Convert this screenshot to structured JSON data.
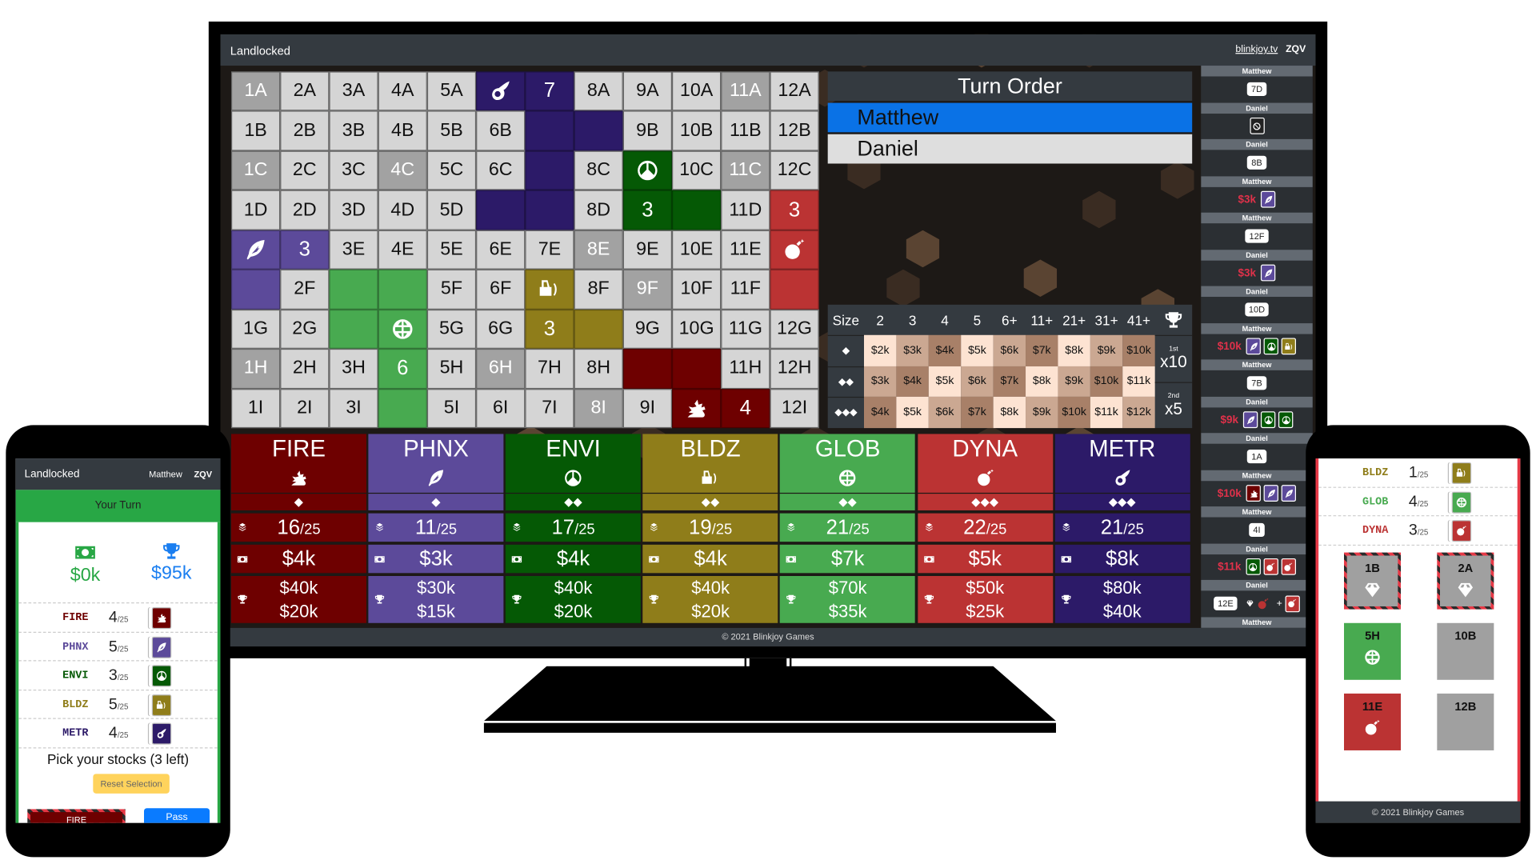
{
  "app": {
    "title": "Landlocked",
    "link": "blinkjoy.tv",
    "room": "ZQV",
    "footer": "© 2021 Blinkjoy Games"
  },
  "colors": {
    "FIRE": "#6e0000",
    "PHNX": "#5c4a9a",
    "ENVI": "#055905",
    "BLDZ": "#8f7d1a",
    "GLOB": "#48aa50",
    "DYNA": "#bb3333",
    "METR": "#2c1a68",
    "active": "#0a72e6",
    "your_turn": "#28a745",
    "cash": "#28a745",
    "worth": "#1a7ef0",
    "reset": "#ffd35c",
    "pass": "#0a7bff"
  },
  "icons": {
    "FIRE": "dragon",
    "PHNX": "feather",
    "ENVI": "peace",
    "BLDZ": "bulldozer",
    "GLOB": "globe",
    "DYNA": "bomb",
    "METR": "comet"
  },
  "board": {
    "rows": [
      [
        {
          "t": "1A",
          "dark": true
        },
        {
          "t": "2A"
        },
        {
          "t": "3A"
        },
        {
          "t": "4A"
        },
        {
          "t": "5A"
        },
        {
          "co": "METR",
          "icon": true
        },
        {
          "co": "METR",
          "t": "7"
        },
        {
          "t": "8A"
        },
        {
          "t": "9A"
        },
        {
          "t": "10A"
        },
        {
          "t": "11A",
          "dark": true
        },
        {
          "t": "12A"
        }
      ],
      [
        {
          "t": "1B"
        },
        {
          "t": "2B"
        },
        {
          "t": "3B"
        },
        {
          "t": "4B"
        },
        {
          "t": "5B"
        },
        {
          "t": "6B"
        },
        {
          "co": "METR"
        },
        {
          "co": "METR"
        },
        {
          "t": "9B"
        },
        {
          "t": "10B"
        },
        {
          "t": "11B"
        },
        {
          "t": "12B"
        }
      ],
      [
        {
          "t": "1C",
          "dark": true
        },
        {
          "t": "2C"
        },
        {
          "t": "3C"
        },
        {
          "t": "4C",
          "dark": true
        },
        {
          "t": "5C"
        },
        {
          "t": "6C"
        },
        {
          "co": "METR"
        },
        {
          "t": "8C"
        },
        {
          "co": "ENVI",
          "icon": true
        },
        {
          "t": "10C"
        },
        {
          "t": "11C",
          "dark": true
        },
        {
          "t": "12C"
        }
      ],
      [
        {
          "t": "1D"
        },
        {
          "t": "2D"
        },
        {
          "t": "3D"
        },
        {
          "t": "4D"
        },
        {
          "t": "5D"
        },
        {
          "co": "METR"
        },
        {
          "co": "METR"
        },
        {
          "t": "8D"
        },
        {
          "co": "ENVI",
          "t": "3"
        },
        {
          "co": "ENVI"
        },
        {
          "t": "11D"
        },
        {
          "co": "DYNA",
          "t": "3"
        }
      ],
      [
        {
          "co": "PHNX",
          "icon": true
        },
        {
          "co": "PHNX",
          "t": "3"
        },
        {
          "t": "3E"
        },
        {
          "t": "4E"
        },
        {
          "t": "5E"
        },
        {
          "t": "6E"
        },
        {
          "t": "7E"
        },
        {
          "t": "8E",
          "dark": true
        },
        {
          "t": "9E"
        },
        {
          "t": "10E"
        },
        {
          "t": "11E"
        },
        {
          "co": "DYNA",
          "icon": true
        }
      ],
      [
        {
          "co": "PHNX"
        },
        {
          "t": "2F"
        },
        {
          "co": "GLOB"
        },
        {
          "co": "GLOB"
        },
        {
          "t": "5F"
        },
        {
          "t": "6F"
        },
        {
          "co": "BLDZ",
          "icon": true
        },
        {
          "t": "8F"
        },
        {
          "t": "9F",
          "dark": true
        },
        {
          "t": "10F"
        },
        {
          "t": "11F"
        },
        {
          "co": "DYNA"
        }
      ],
      [
        {
          "t": "1G"
        },
        {
          "t": "2G"
        },
        {
          "co": "GLOB"
        },
        {
          "co": "GLOB",
          "icon": true
        },
        {
          "t": "5G"
        },
        {
          "t": "6G"
        },
        {
          "co": "BLDZ",
          "t": "3"
        },
        {
          "co": "BLDZ"
        },
        {
          "t": "9G"
        },
        {
          "t": "10G"
        },
        {
          "t": "11G"
        },
        {
          "t": "12G"
        }
      ],
      [
        {
          "t": "1H",
          "dark": true
        },
        {
          "t": "2H"
        },
        {
          "t": "3H"
        },
        {
          "co": "GLOB",
          "t": "6"
        },
        {
          "t": "5H"
        },
        {
          "t": "6H",
          "dark": true
        },
        {
          "t": "7H"
        },
        {
          "t": "8H"
        },
        {
          "co": "FIRE"
        },
        {
          "co": "FIRE"
        },
        {
          "t": "11H"
        },
        {
          "t": "12H"
        }
      ],
      [
        {
          "t": "1I"
        },
        {
          "t": "2I"
        },
        {
          "t": "3I"
        },
        {
          "co": "GLOB"
        },
        {
          "t": "5I"
        },
        {
          "t": "6I"
        },
        {
          "t": "7I"
        },
        {
          "t": "8I",
          "dark": true
        },
        {
          "t": "9I"
        },
        {
          "co": "FIRE",
          "icon": true
        },
        {
          "co": "FIRE",
          "t": "4"
        },
        {
          "t": "12I"
        }
      ]
    ]
  },
  "turn_order": {
    "title": "Turn Order",
    "players": [
      {
        "name": "Matthew",
        "active": true
      },
      {
        "name": "Daniel",
        "active": false
      }
    ]
  },
  "price_table": {
    "header": [
      "Size",
      "2",
      "3",
      "4",
      "5",
      "6+",
      "11+",
      "21+",
      "31+",
      "41+"
    ],
    "rows": [
      {
        "size": "◆",
        "prices": [
          "$2k",
          "$3k",
          "$4k",
          "$5k",
          "$6k",
          "$7k",
          "$8k",
          "$9k",
          "$10k"
        ]
      },
      {
        "size": "◆◆",
        "prices": [
          "$3k",
          "$4k",
          "$5k",
          "$6k",
          "$7k",
          "$8k",
          "$9k",
          "$10k",
          "$11k"
        ]
      },
      {
        "size": "◆◆◆",
        "prices": [
          "$4k",
          "$5k",
          "$6k",
          "$7k",
          "$8k",
          "$9k",
          "$10k",
          "$11k",
          "$12k"
        ]
      }
    ],
    "first": {
      "label": "1st",
      "mult": "x10"
    },
    "second": {
      "label": "2nd",
      "mult": "x5"
    }
  },
  "log": [
    {
      "player": "Matthew",
      "tile": "7D"
    },
    {
      "player": "Daniel",
      "blocked": true
    },
    {
      "player": "Daniel",
      "tile": "8B"
    },
    {
      "player": "Matthew",
      "price": "$3k",
      "stocks": [
        "PHNX"
      ]
    },
    {
      "player": "Matthew",
      "tile": "12F"
    },
    {
      "player": "Daniel",
      "price": "$3k",
      "stocks": [
        "PHNX"
      ]
    },
    {
      "player": "Daniel",
      "tile": "10D"
    },
    {
      "player": "Matthew",
      "price": "$10k",
      "stocks": [
        "PHNX",
        "ENVI",
        "BLDZ"
      ]
    },
    {
      "player": "Matthew",
      "tile": "7B"
    },
    {
      "player": "Daniel",
      "price": "$9k",
      "stocks": [
        "PHNX",
        "ENVI",
        "ENVI"
      ]
    },
    {
      "player": "Daniel",
      "tile": "1A"
    },
    {
      "player": "Matthew",
      "price": "$10k",
      "stocks": [
        "FIRE",
        "PHNX",
        "PHNX"
      ]
    },
    {
      "player": "Matthew",
      "tile": "4I"
    },
    {
      "player": "Daniel",
      "price": "$11k",
      "stocks": [
        "ENVI",
        "DYNA",
        "DYNA"
      ]
    },
    {
      "player": "Daniel",
      "tile": "12E",
      "founded": "DYNA",
      "bonus": "+",
      "bonus_stock": "DYNA"
    },
    {
      "player": "Matthew"
    }
  ],
  "companies": [
    {
      "name": "FIRE",
      "size": "◆",
      "shares": "16",
      "total": "/25",
      "price": "$4k",
      "bonus1": "$40k",
      "bonus2": "$20k"
    },
    {
      "name": "PHNX",
      "size": "◆",
      "shares": "11",
      "total": "/25",
      "price": "$3k",
      "bonus1": "$30k",
      "bonus2": "$15k"
    },
    {
      "name": "ENVI",
      "size": "◆◆",
      "shares": "17",
      "total": "/25",
      "price": "$4k",
      "bonus1": "$40k",
      "bonus2": "$20k"
    },
    {
      "name": "BLDZ",
      "size": "◆◆",
      "shares": "19",
      "total": "/25",
      "price": "$4k",
      "bonus1": "$40k",
      "bonus2": "$20k"
    },
    {
      "name": "GLOB",
      "size": "◆◆",
      "shares": "21",
      "total": "/25",
      "price": "$7k",
      "bonus1": "$70k",
      "bonus2": "$35k"
    },
    {
      "name": "DYNA",
      "size": "◆◆◆",
      "shares": "22",
      "total": "/25",
      "price": "$5k",
      "bonus1": "$50k",
      "bonus2": "$25k"
    },
    {
      "name": "METR",
      "size": "◆◆◆",
      "shares": "21",
      "total": "/25",
      "price": "$8k",
      "bonus1": "$80k",
      "bonus2": "$40k"
    }
  ],
  "phone_left": {
    "title": "Landlocked",
    "player": "Matthew",
    "room": "ZQV",
    "status": "Your Turn",
    "cash": "$0k",
    "worth": "$95k",
    "stocks": [
      {
        "co": "FIRE",
        "count": "4",
        "total": "/25"
      },
      {
        "co": "PHNX",
        "count": "5",
        "total": "/25"
      },
      {
        "co": "ENVI",
        "count": "3",
        "total": "/25"
      },
      {
        "co": "BLDZ",
        "count": "5",
        "total": "/25"
      },
      {
        "co": "METR",
        "count": "4",
        "total": "/25"
      }
    ],
    "prompt": "Pick your stocks (3 left)",
    "reset": "Reset Selection",
    "buy_partial": "FIRE",
    "pass": "Pass"
  },
  "phone_right": {
    "stocks": [
      {
        "co": "BLDZ",
        "count": "1",
        "total": "/25"
      },
      {
        "co": "GLOB",
        "count": "4",
        "total": "/25"
      },
      {
        "co": "DYNA",
        "count": "3",
        "total": "/25"
      }
    ],
    "tiles": [
      {
        "t": "1B",
        "unplayable": true
      },
      {
        "t": "2A",
        "unplayable": true
      },
      {
        "t": "5H",
        "co": "GLOB"
      },
      {
        "t": "10B"
      },
      {
        "t": "11E",
        "co": "DYNA"
      },
      {
        "t": "12B"
      }
    ],
    "footer": "© 2021 Blinkjoy Games"
  }
}
